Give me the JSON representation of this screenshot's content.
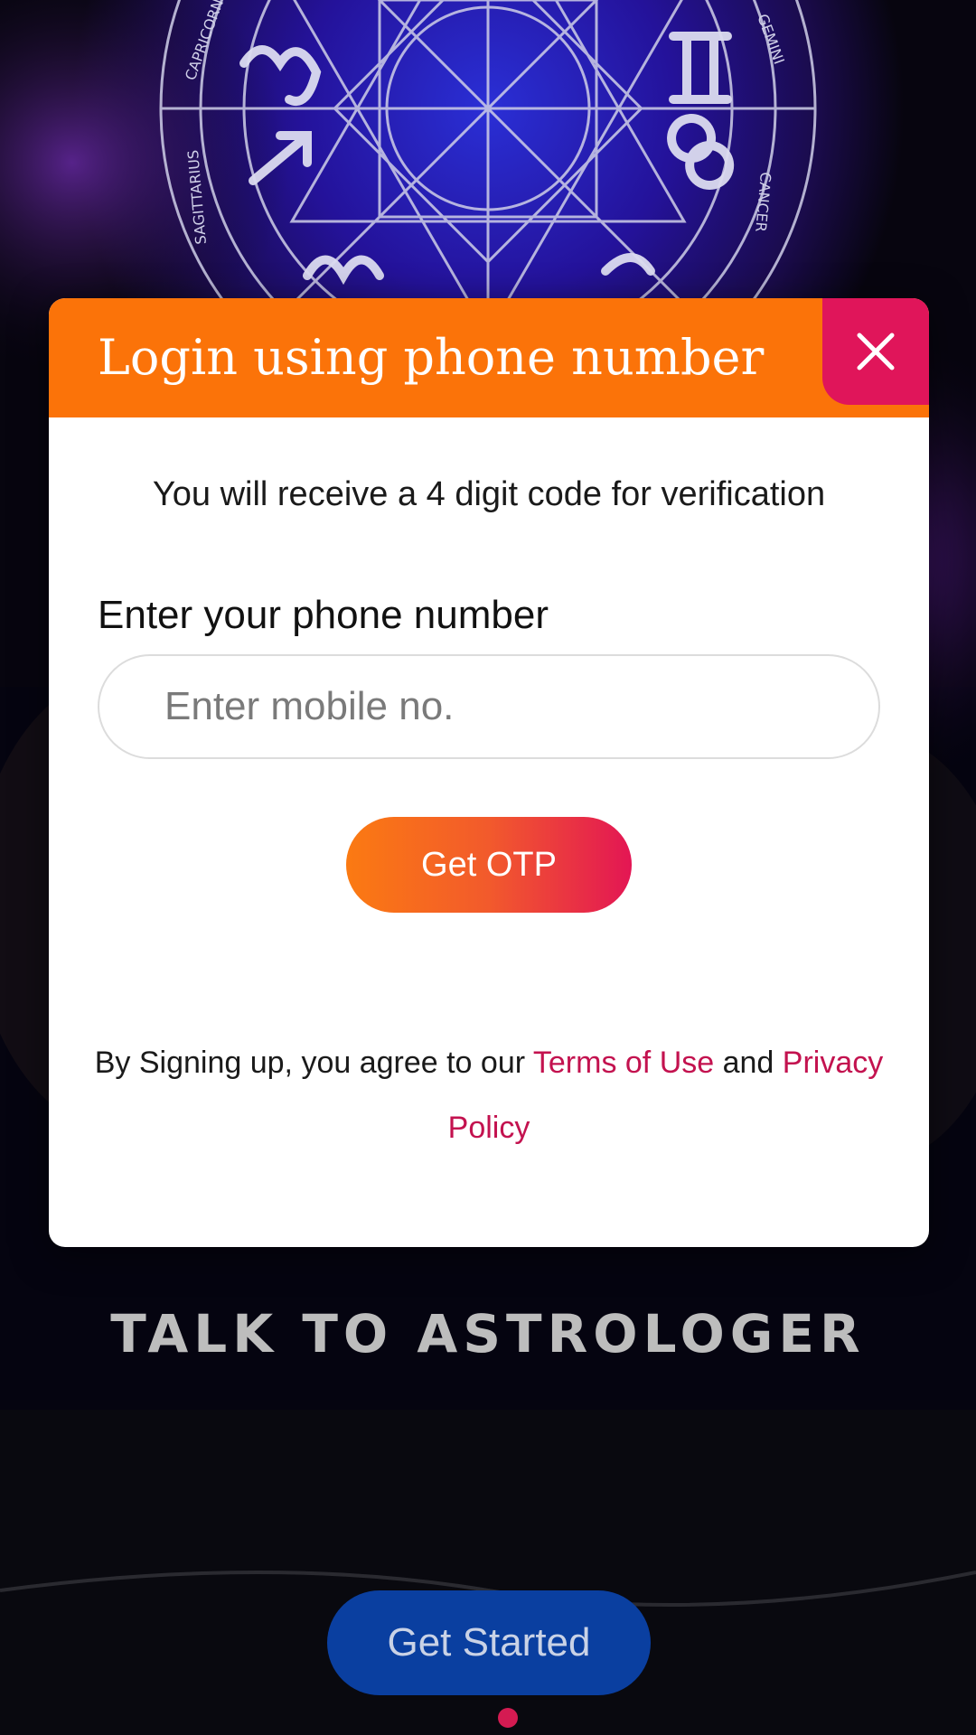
{
  "background": {
    "zodiac_labels": [
      "CAPRICORN",
      "SAGITTARIUS",
      "GEMINI",
      "CANCER"
    ],
    "headline": "TALK TO ASTROLOGER",
    "get_started_label": "Get Started",
    "pager": {
      "active_index": 0,
      "count": 1
    }
  },
  "dialog": {
    "title": "Login using phone number",
    "subtitle": "You will receive a 4 digit code for verification",
    "phone_label": "Enter your phone number",
    "phone_input": {
      "value": "",
      "placeholder": "Enter mobile no."
    },
    "otp_button_label": "Get OTP",
    "terms": {
      "prefix": "By Signing up, you agree to our ",
      "terms_link": "Terms of Use",
      "middle": " and ",
      "privacy_link": "Privacy Policy"
    }
  },
  "colors": {
    "header_orange": "#fb7309",
    "close_pink": "#e0155a",
    "link_pink": "#c3124f",
    "get_started_blue": "#0a3fa0"
  },
  "icons": {
    "close": "close-icon",
    "zodiac_wheel": "zodiac-wheel-icon"
  }
}
